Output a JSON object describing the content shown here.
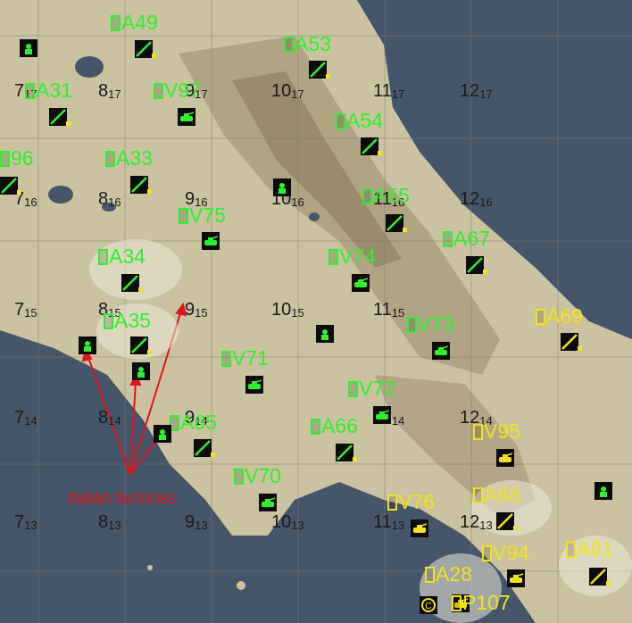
{
  "map": {
    "grid_labels": [
      {
        "col": "7",
        "row": "17"
      },
      {
        "col": "8",
        "row": "17"
      },
      {
        "col": "9",
        "row": "17"
      },
      {
        "col": "10",
        "row": "17"
      },
      {
        "col": "11",
        "row": "17"
      },
      {
        "col": "12",
        "row": "17"
      },
      {
        "col": "7",
        "row": "16"
      },
      {
        "col": "8",
        "row": "16"
      },
      {
        "col": "9",
        "row": "16"
      },
      {
        "col": "10",
        "row": "16"
      },
      {
        "col": "11",
        "row": "16"
      },
      {
        "col": "12",
        "row": "16"
      },
      {
        "col": "7",
        "row": "15"
      },
      {
        "col": "8",
        "row": "15"
      },
      {
        "col": "9",
        "row": "15"
      },
      {
        "col": "10",
        "row": "15"
      },
      {
        "col": "11",
        "row": "15"
      },
      {
        "col": "7",
        "row": "14"
      },
      {
        "col": "8",
        "row": "14"
      },
      {
        "col": "9",
        "row": "14"
      },
      {
        "col": "11",
        "row": "14"
      },
      {
        "col": "12",
        "row": "14"
      },
      {
        "col": "7",
        "row": "13"
      },
      {
        "col": "8",
        "row": "13"
      },
      {
        "col": "9",
        "row": "13"
      },
      {
        "col": "10",
        "row": "13"
      },
      {
        "col": "11",
        "row": "13"
      },
      {
        "col": "12",
        "row": "13"
      }
    ],
    "units": [
      {
        "label": "A49",
        "side": "allied"
      },
      {
        "label": "A53",
        "side": "allied"
      },
      {
        "label": "A31",
        "side": "allied"
      },
      {
        "label": "V97",
        "side": "allied"
      },
      {
        "label": "A54",
        "side": "allied"
      },
      {
        "label": "96",
        "side": "allied"
      },
      {
        "label": "A33",
        "side": "allied"
      },
      {
        "label": "A55",
        "side": "allied"
      },
      {
        "label": "V75",
        "side": "allied"
      },
      {
        "label": "A67",
        "side": "allied"
      },
      {
        "label": "V74",
        "side": "allied"
      },
      {
        "label": "A34",
        "side": "allied"
      },
      {
        "label": "A35",
        "side": "allied"
      },
      {
        "label": "V73",
        "side": "allied"
      },
      {
        "label": "A69",
        "side": "axis"
      },
      {
        "label": "V71",
        "side": "allied"
      },
      {
        "label": "V72",
        "side": "allied"
      },
      {
        "label": "A65",
        "side": "allied"
      },
      {
        "label": "A66",
        "side": "allied"
      },
      {
        "label": "V95",
        "side": "axis"
      },
      {
        "label": "V70",
        "side": "allied"
      },
      {
        "label": "V76",
        "side": "axis"
      },
      {
        "label": "A68",
        "side": "axis"
      },
      {
        "label": "V94",
        "side": "axis"
      },
      {
        "label": "A81",
        "side": "axis"
      },
      {
        "label": "A28",
        "side": "axis"
      },
      {
        "label": "P107",
        "side": "axis"
      }
    ],
    "annotation": {
      "text": "Italian factories"
    },
    "colors": {
      "allied": "#2ef02e",
      "axis": "#f2e21b",
      "annotation": "#e0141a",
      "sea": "#46566a",
      "land": "#cfc6a4"
    }
  }
}
